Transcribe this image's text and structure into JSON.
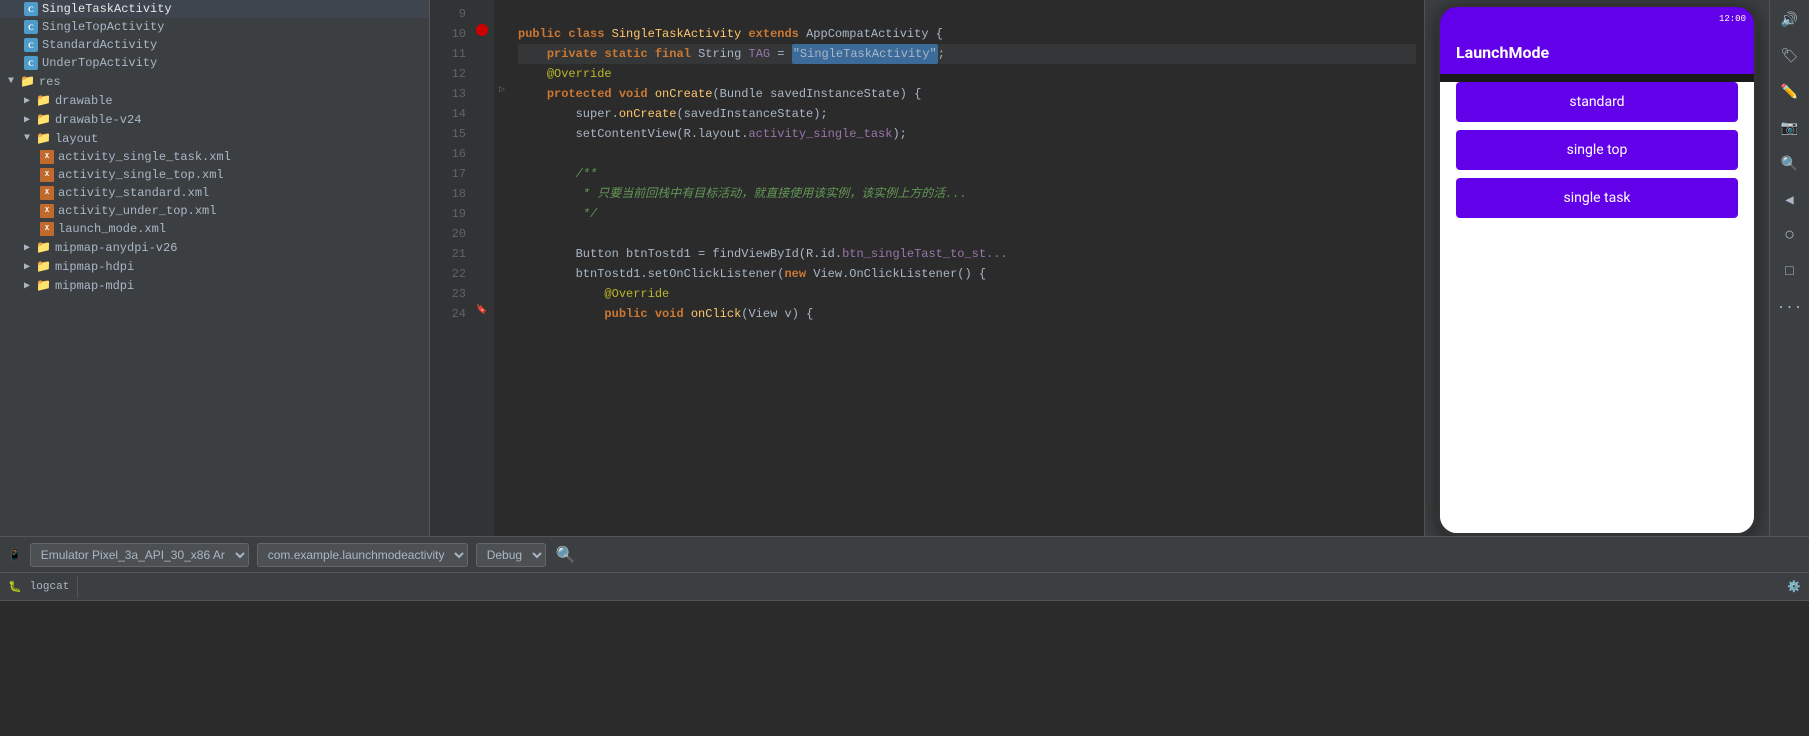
{
  "sidebar": {
    "items": [
      {
        "label": "SingleTaskActivity",
        "type": "class",
        "indent": 2,
        "selected": false
      },
      {
        "label": "SingleTopActivity",
        "type": "class",
        "indent": 2,
        "selected": false
      },
      {
        "label": "StandardActivity",
        "type": "class",
        "indent": 2,
        "selected": false
      },
      {
        "label": "UnderTopActivity",
        "type": "class",
        "indent": 2,
        "selected": false
      },
      {
        "label": "res",
        "type": "folder",
        "indent": 1,
        "expanded": true
      },
      {
        "label": "drawable",
        "type": "folder",
        "indent": 2,
        "expanded": false
      },
      {
        "label": "drawable-v24",
        "type": "folder",
        "indent": 2,
        "expanded": false
      },
      {
        "label": "layout",
        "type": "folder",
        "indent": 2,
        "expanded": true
      },
      {
        "label": "activity_single_task.xml",
        "type": "xml",
        "indent": 3
      },
      {
        "label": "activity_single_top.xml",
        "type": "xml",
        "indent": 3
      },
      {
        "label": "activity_standard.xml",
        "type": "xml",
        "indent": 3
      },
      {
        "label": "activity_under_top.xml",
        "type": "xml",
        "indent": 3
      },
      {
        "label": "launch_mode.xml",
        "type": "xml",
        "indent": 3
      },
      {
        "label": "mipmap-anydpi-v26",
        "type": "folder",
        "indent": 2,
        "expanded": false
      },
      {
        "label": "mipmap-hdpi",
        "type": "folder",
        "indent": 2,
        "expanded": false
      },
      {
        "label": "mipmap-mdpi",
        "type": "folder",
        "indent": 2,
        "expanded": false
      }
    ]
  },
  "editor": {
    "lines": [
      {
        "num": 9,
        "content_type": "blank"
      },
      {
        "num": 10,
        "content_type": "code",
        "raw": "public class SingleTaskActivity extends AppCompatActivity {"
      },
      {
        "num": 11,
        "content_type": "code_highlight",
        "raw": "    private static final String TAG = \"SingleTaskActivity\";"
      },
      {
        "num": 12,
        "content_type": "annotation",
        "raw": "    @Override"
      },
      {
        "num": 13,
        "content_type": "code",
        "raw": "    protected void onCreate(Bundle savedInstanceState) {"
      },
      {
        "num": 14,
        "content_type": "code",
        "raw": "        super.onCreate(savedInstanceState);"
      },
      {
        "num": 15,
        "content_type": "code",
        "raw": "        setContentView(R.layout.activity_single_task);"
      },
      {
        "num": 16,
        "content_type": "blank"
      },
      {
        "num": 17,
        "content_type": "comment",
        "raw": "        /**"
      },
      {
        "num": 18,
        "content_type": "comment",
        "raw": "         * 只要当前回栈中有目标活动，就直接使用该实例，该实例上方的活..."
      },
      {
        "num": 19,
        "content_type": "comment",
        "raw": "         */"
      },
      {
        "num": 20,
        "content_type": "blank"
      },
      {
        "num": 21,
        "content_type": "code",
        "raw": "        Button btnTostd1 = findViewById(R.id.btn_singleTast_to_st..."
      },
      {
        "num": 22,
        "content_type": "code",
        "raw": "        btnTostd1.setOnClickListener(new View.OnClickListener() {"
      },
      {
        "num": 23,
        "content_type": "annotation",
        "raw": "            @Override"
      },
      {
        "num": 24,
        "content_type": "code",
        "raw": "            public void onClick(View v) {"
      }
    ]
  },
  "device": {
    "title": "LaunchMode",
    "buttons": [
      {
        "label": "standard"
      },
      {
        "label": "single top"
      },
      {
        "label": "single task"
      }
    ],
    "status_bar_visible": true
  },
  "bottom_toolbar": {
    "emulator": "Emulator Pixel_3a_API_30_x86 Ar",
    "package": "com.example.launchmodeactivity",
    "build": "Debug",
    "search_placeholder": "",
    "logcat_label": "logcat"
  },
  "right_toolbar": {
    "icons": [
      "🔊",
      "🏷",
      "✏️",
      "📷",
      "🔍",
      "◀",
      "⬤",
      "⬛",
      "···"
    ]
  }
}
